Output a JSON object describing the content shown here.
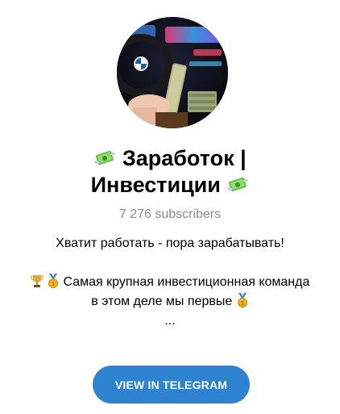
{
  "channel": {
    "title_line1": "Заработок |",
    "title_line2": "Инвестиции",
    "subscribers": "7 276 subscribers",
    "description": {
      "line1": "Хватит работать - пора зарабатывать!",
      "line2": "Самая крупная инвестиционная команда",
      "line3": "в этом деле мы первые",
      "line4": "..."
    },
    "icons": {
      "title_left": "money-with-wings-icon",
      "title_right": "money-with-wings-icon",
      "desc_trophy": "trophy-icon",
      "desc_medal": "medal-icon"
    }
  },
  "cta": {
    "label": "VIEW IN TELEGRAM",
    "color": "#2d83cf"
  },
  "colors": {
    "subscribers_text": "#8a8a8a",
    "money_green": "#4caf50"
  }
}
